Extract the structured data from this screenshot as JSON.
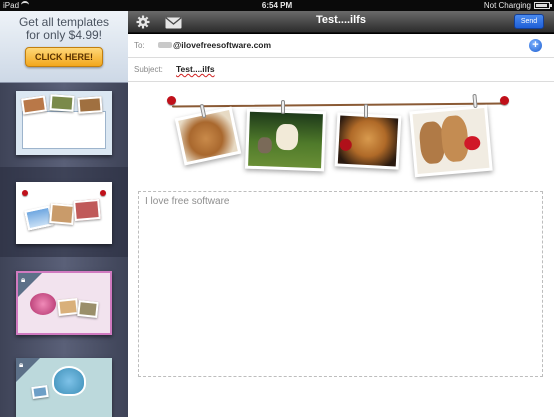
{
  "status_bar": {
    "device": "iPad",
    "time": "6:54 PM",
    "battery_status": "Not Charging"
  },
  "sidebar": {
    "promo": {
      "line1": "Get all templates",
      "line2": "for only $4.99!",
      "button_label": "CLICK HERE!"
    },
    "templates": [
      {
        "name": "photo-strip-blue",
        "locked": false,
        "selected": false
      },
      {
        "name": "photo-collage-white",
        "locked": false,
        "selected": true
      },
      {
        "name": "rose-pink",
        "locked": true,
        "selected": false
      },
      {
        "name": "heart-teal",
        "locked": true,
        "selected": false
      }
    ]
  },
  "header": {
    "title": "Test....ilfs",
    "send_label": "Send",
    "icons": [
      "gear-icon",
      "mail-icon"
    ]
  },
  "compose": {
    "to_label": "To:",
    "to_value": "@ilovefreesoftware.com",
    "subject_label": "Subject:",
    "subject_value": "Test....ilfs",
    "body_text": "I love free software",
    "add_icon": "plus-icon"
  },
  "colors": {
    "send_button": "#2266dd",
    "promo_button": "#f3a71c",
    "sidebar_bg": "#4a5068",
    "pin": "#c0101a"
  }
}
